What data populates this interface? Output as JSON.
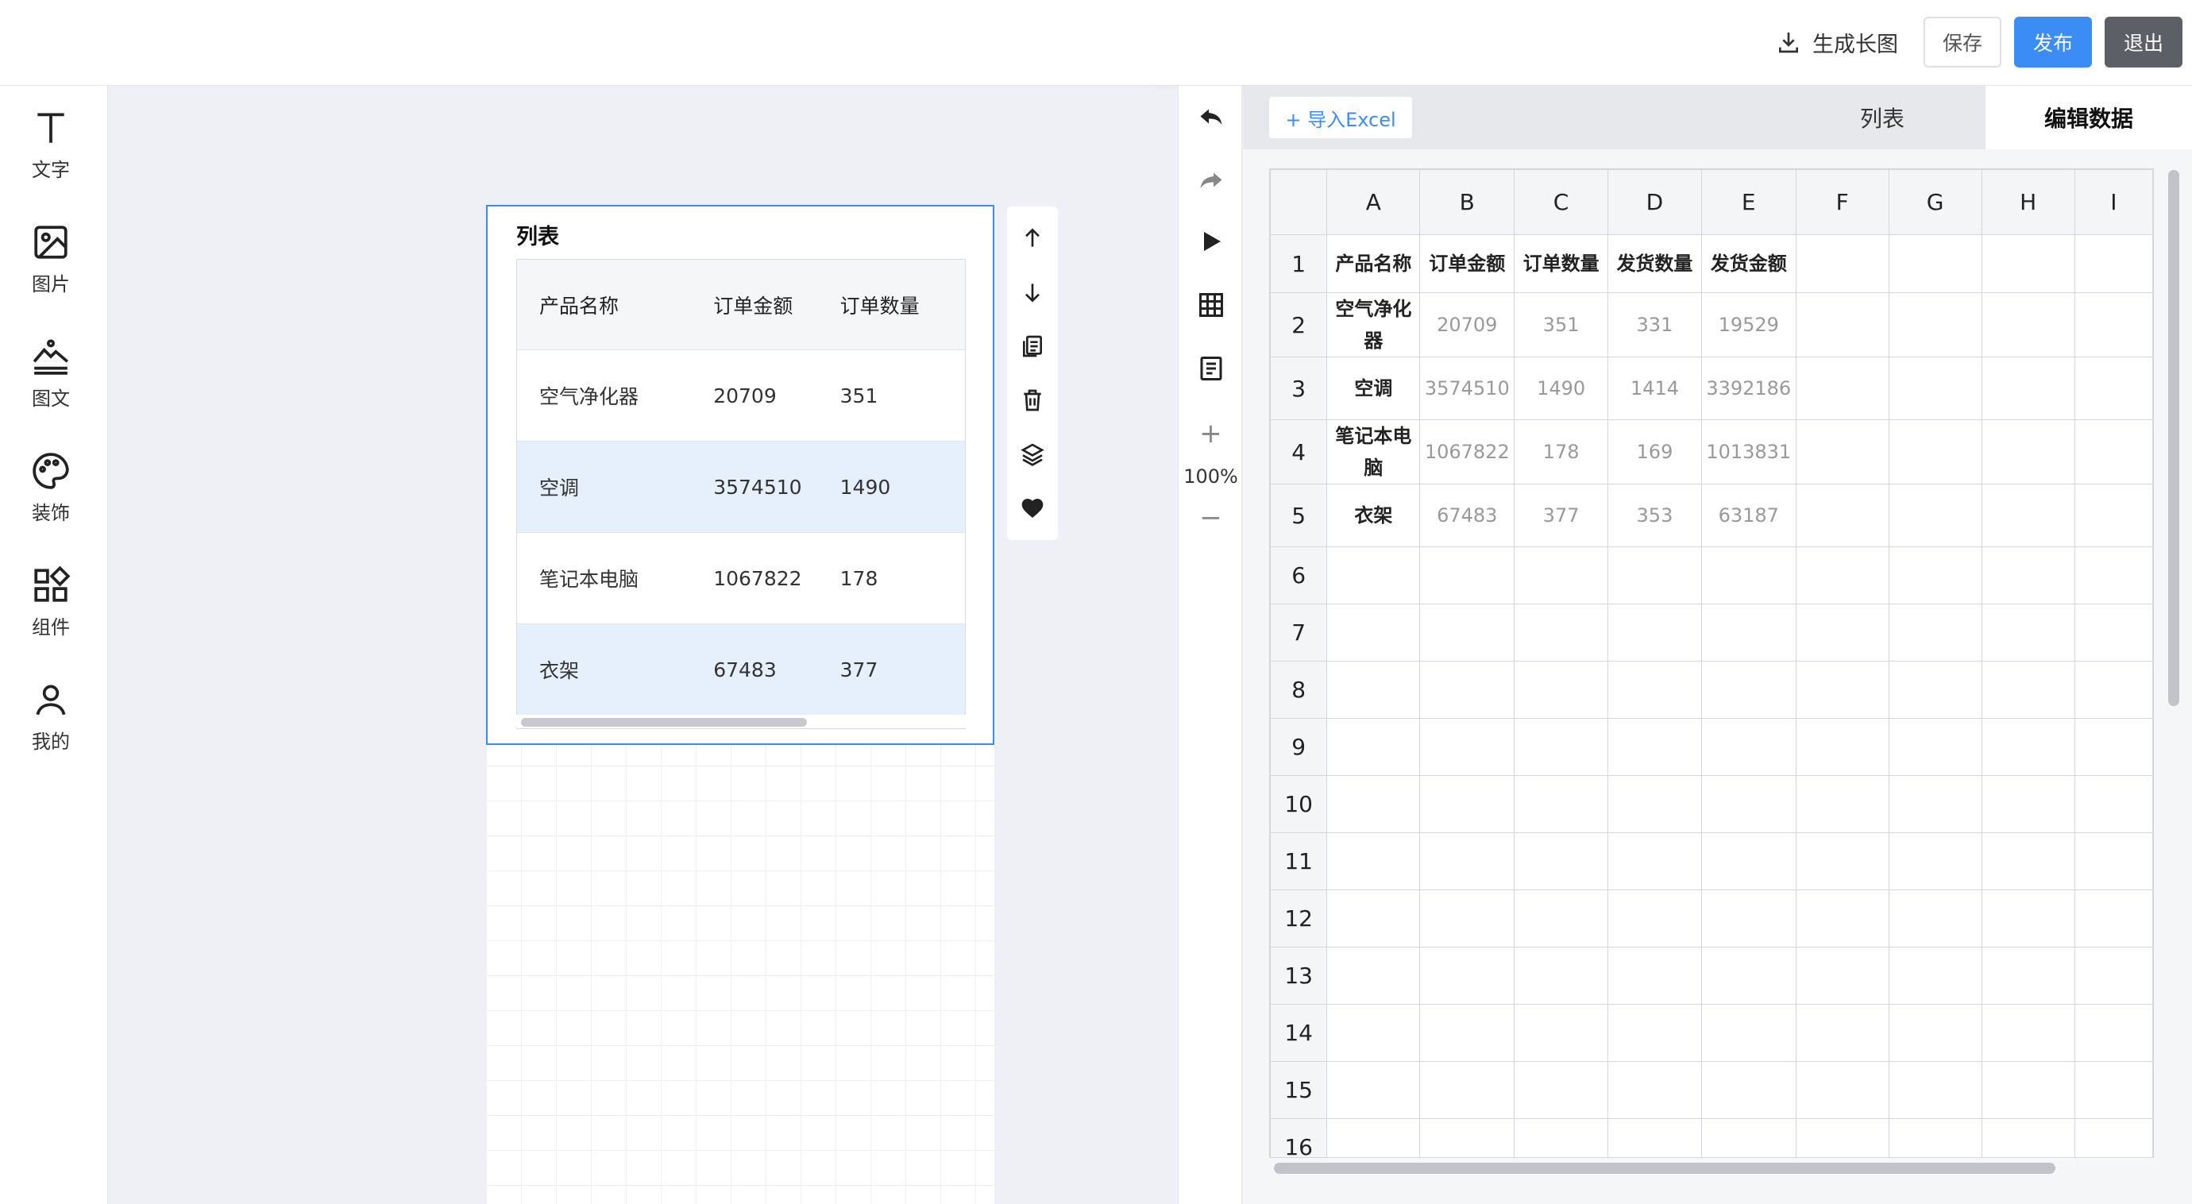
{
  "topbar": {
    "generate_label": "生成长图",
    "save_label": "保存",
    "publish_label": "发布",
    "exit_label": "退出"
  },
  "sidebar": {
    "items": [
      {
        "label": "文字",
        "icon": "text-icon"
      },
      {
        "label": "图片",
        "icon": "image-icon"
      },
      {
        "label": "图文",
        "icon": "image-text-icon"
      },
      {
        "label": "装饰",
        "icon": "palette-icon"
      },
      {
        "label": "组件",
        "icon": "components-icon"
      },
      {
        "label": "我的",
        "icon": "user-icon"
      }
    ]
  },
  "widget": {
    "title": "列表",
    "headers": [
      "产品名称",
      "订单金额",
      "订单数量"
    ],
    "rows": [
      [
        "空气净化器",
        "20709",
        "351"
      ],
      [
        "空调",
        "3574510",
        "1490"
      ],
      [
        "笔记本电脑",
        "1067822",
        "178"
      ],
      [
        "衣架",
        "67483",
        "377"
      ]
    ]
  },
  "vtool": {
    "zoom": "100%",
    "zoom_in": "+",
    "zoom_out": "−"
  },
  "rpanel": {
    "import_label": "+ 导入Excel",
    "tabs": [
      "列表",
      "编辑数据"
    ],
    "active_tab": "编辑数据",
    "columns": [
      "A",
      "B",
      "C",
      "D",
      "E",
      "F",
      "G",
      "H",
      "I"
    ],
    "row_numbers": [
      "1",
      "2",
      "3",
      "4",
      "5",
      "6",
      "7",
      "8",
      "9",
      "10",
      "11",
      "12",
      "13",
      "14",
      "15",
      "16"
    ],
    "cells": [
      [
        "产品名称",
        "订单金额",
        "订单数量",
        "发货数量",
        "发货金额"
      ],
      [
        "空气净化器",
        "20709",
        "351",
        "331",
        "19529"
      ],
      [
        "空调",
        "3574510",
        "1490",
        "1414",
        "3392186"
      ],
      [
        "笔记本电脑",
        "1067822",
        "178",
        "169",
        "1013831"
      ],
      [
        "衣架",
        "67483",
        "377",
        "353",
        "63187"
      ]
    ]
  }
}
